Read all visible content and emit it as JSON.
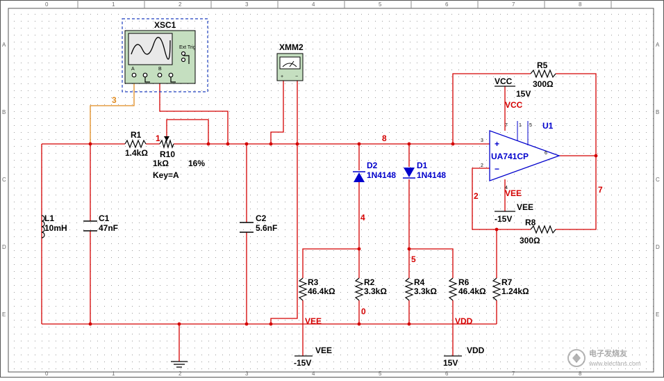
{
  "ruler": {
    "columns": [
      "0",
      "1",
      "2",
      "3",
      "4",
      "5",
      "6",
      "7",
      "8"
    ],
    "rows": [
      "A",
      "B",
      "C",
      "D",
      "E"
    ]
  },
  "instruments": {
    "oscilloscope": {
      "name": "XSC1",
      "ext_trig": "Ext Trig",
      "ch_a": "A",
      "ch_b": "B"
    },
    "multimeter": {
      "name": "XMM2"
    }
  },
  "components": {
    "R1": {
      "ref": "R1",
      "value": "1.4kΩ"
    },
    "R10": {
      "ref": "R10",
      "value": "1kΩ",
      "percent": "16%",
      "key": "Key=A"
    },
    "L1": {
      "ref": "L1",
      "value": "10mH"
    },
    "C1": {
      "ref": "C1",
      "value": "47nF"
    },
    "C2": {
      "ref": "C2",
      "value": "5.6nF"
    },
    "D2": {
      "ref": "D2",
      "value": "1N4148"
    },
    "D1": {
      "ref": "D1",
      "value": "1N4148"
    },
    "R3": {
      "ref": "R3",
      "value": "46.4kΩ"
    },
    "R2": {
      "ref": "R2",
      "value": "3.3kΩ"
    },
    "R4": {
      "ref": "R4",
      "value": "3.3kΩ"
    },
    "R6": {
      "ref": "R6",
      "value": "46.4kΩ"
    },
    "R7": {
      "ref": "R7",
      "value": "1.24kΩ"
    },
    "R5": {
      "ref": "R5",
      "value": "300Ω"
    },
    "R8": {
      "ref": "R8",
      "value": "300Ω"
    },
    "U1": {
      "ref": "U1",
      "part": "UA741CP",
      "pin_plus": "+",
      "pin_minus": "−",
      "pin3": "3",
      "pin2": "2",
      "pin6": "6",
      "pin7": "7",
      "pin4": "4",
      "pin5": "5",
      "pin1": "1"
    }
  },
  "power": {
    "vcc_label": "VCC",
    "vcc_value": "15V",
    "vcc_net": "VCC",
    "vee_label": "VEE",
    "vee_value": "-15V",
    "vee_net": "VEE",
    "vee2_label": "VEE",
    "vee2_value": "-15V",
    "vee2_net": "VEE",
    "vdd_label": "VDD",
    "vdd_value": "15V",
    "vdd_net": "VDD"
  },
  "nets": {
    "n1": "1",
    "n2": "2",
    "n3": "3",
    "n4": "4",
    "n5": "5",
    "n7": "7",
    "n8": "8",
    "n0": "0"
  },
  "watermark": "电子发烧友\nwww.elecfans.com",
  "colors": {
    "wire": "#d40000",
    "probe_wire": "#e08a1e",
    "part_blue": "#0000cc",
    "instrument_bg": "#c5dfc0",
    "dash_blue": "#1f3fbf"
  }
}
